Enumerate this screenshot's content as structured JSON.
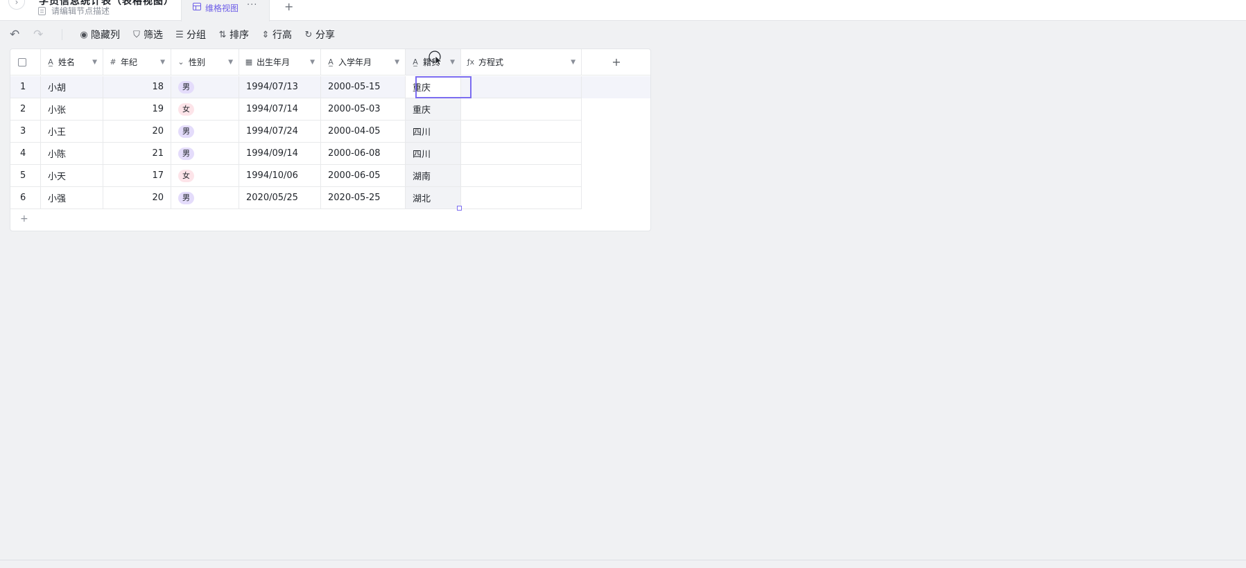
{
  "tabbar": {
    "collapse_icon": "chevron-right-icon",
    "collapse_glyph": "›",
    "node_title": "学员信息统计表（表格视图）",
    "node_desc": "请编辑节点描述",
    "view_tab_label": "维格视图",
    "more_glyph": "···",
    "add_tab_glyph": "+"
  },
  "toolbar": {
    "undo_glyph": "↶",
    "redo_glyph": "↷",
    "items": [
      {
        "label": "隐藏列",
        "icon": "eye-icon",
        "glyph": "◉"
      },
      {
        "label": "筛选",
        "icon": "filter-icon",
        "glyph": "⛉"
      },
      {
        "label": "分组",
        "icon": "list-icon",
        "glyph": "☰"
      },
      {
        "label": "排序",
        "icon": "sort-icon",
        "glyph": "⇅"
      },
      {
        "label": "行高",
        "icon": "row-height-icon",
        "glyph": "⇕"
      },
      {
        "label": "分享",
        "icon": "share-icon",
        "glyph": "↻"
      }
    ]
  },
  "table": {
    "columns": [
      {
        "label": "姓名",
        "icon": "text-icon",
        "glyph": "A̲"
      },
      {
        "label": "年纪",
        "icon": "number-icon",
        "glyph": "#"
      },
      {
        "label": "性别",
        "icon": "single-select-icon",
        "glyph": "⌄"
      },
      {
        "label": "出生年月",
        "icon": "date-icon",
        "glyph": "▦"
      },
      {
        "label": "入学年月",
        "icon": "text-icon",
        "glyph": "A̲"
      },
      {
        "label": "籍贯",
        "icon": "text-icon",
        "glyph": "A̲"
      },
      {
        "label": "方程式",
        "icon": "formula-icon",
        "glyph": "ƒx"
      }
    ],
    "caret_glyph": "▼",
    "add_column_glyph": "+",
    "rows": [
      {
        "index": "1",
        "name": "小胡",
        "age": "18",
        "gender": "男",
        "gender_type": "male",
        "birth": "1994/07/13",
        "enroll": "2000-05-15",
        "origin": "重庆",
        "formula": ""
      },
      {
        "index": "2",
        "name": "小张",
        "age": "19",
        "gender": "女",
        "gender_type": "female",
        "birth": "1994/07/14",
        "enroll": "2000-05-03",
        "origin": "重庆",
        "formula": ""
      },
      {
        "index": "3",
        "name": "小王",
        "age": "20",
        "gender": "男",
        "gender_type": "male",
        "birth": "1994/07/24",
        "enroll": "2000-04-05",
        "origin": "四川",
        "formula": ""
      },
      {
        "index": "4",
        "name": "小陈",
        "age": "21",
        "gender": "男",
        "gender_type": "male",
        "birth": "1994/09/14",
        "enroll": "2000-06-08",
        "origin": "四川",
        "formula": ""
      },
      {
        "index": "5",
        "name": "小天",
        "age": "17",
        "gender": "女",
        "gender_type": "female",
        "birth": "1994/10/06",
        "enroll": "2000-06-05",
        "origin": "湖南",
        "formula": ""
      },
      {
        "index": "6",
        "name": "小强",
        "age": "20",
        "gender": "男",
        "gender_type": "male",
        "birth": "2020/05/25",
        "enroll": "2020-05-25",
        "origin": "湖北",
        "formula": ""
      }
    ],
    "add_row_glyph": "+"
  },
  "colors": {
    "accent": "#6c5ce7",
    "male_tag": "#e4dcfb",
    "female_tag": "#fde4e9"
  }
}
